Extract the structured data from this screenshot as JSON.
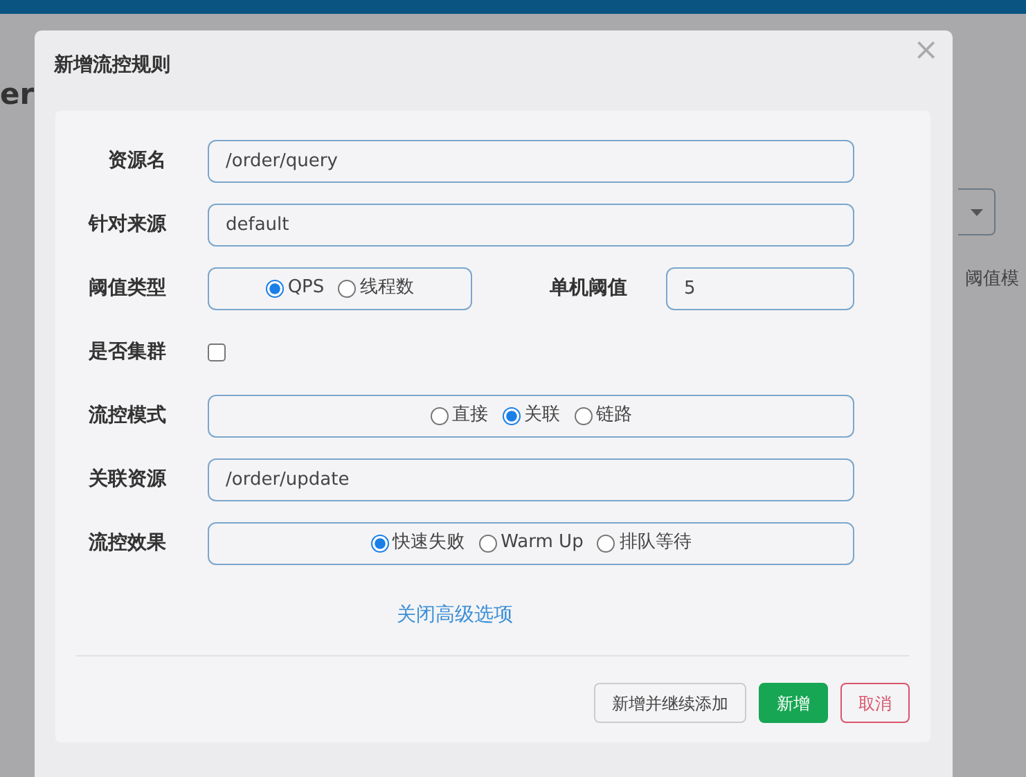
{
  "page": {
    "title": "er",
    "column_header": "阈值模"
  },
  "dialog": {
    "title": "新增流控规则",
    "close": "×",
    "fields": [
      {
        "kind": "text",
        "label": "资源名",
        "value": "/order/query"
      },
      {
        "kind": "text",
        "label": "针对来源",
        "value": "default"
      },
      {
        "kind": "radio_pair",
        "label": "阈值类型",
        "options": [
          {
            "label": "QPS",
            "selected": true
          },
          {
            "label": "线程数",
            "selected": false
          }
        ],
        "side_label": "单机阈值",
        "side_value": "5"
      },
      {
        "kind": "checkbox",
        "label": "是否集群",
        "checked": false
      },
      {
        "kind": "radio",
        "label": "流控模式",
        "options": [
          {
            "label": "直接",
            "selected": false
          },
          {
            "label": "关联",
            "selected": true
          },
          {
            "label": "链路",
            "selected": false
          }
        ]
      },
      {
        "kind": "text",
        "label": "关联资源",
        "value": "/order/update"
      },
      {
        "kind": "radio",
        "label": "流控效果",
        "options": [
          {
            "label": "快速失败",
            "selected": true
          },
          {
            "label": "Warm Up",
            "selected": false
          },
          {
            "label": "排队等待",
            "selected": false
          }
        ]
      }
    ],
    "toggle_link": "关闭高级选项",
    "buttons": [
      {
        "label": "新增并继续添加",
        "kind": "default"
      },
      {
        "label": "新增",
        "kind": "primary"
      },
      {
        "label": "取消",
        "kind": "danger"
      }
    ]
  }
}
